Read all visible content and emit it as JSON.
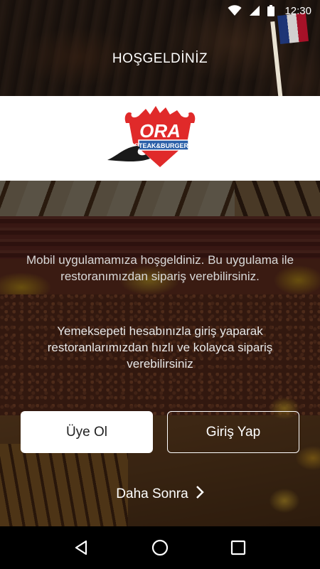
{
  "status_bar": {
    "time": "12:30",
    "icons": [
      "wifi-icon",
      "cellular-signal-icon",
      "battery-icon"
    ]
  },
  "header": {
    "title": "HOŞGELDİNİZ"
  },
  "logo": {
    "brand": "ORA",
    "tagline": "STEAK&BURGERS",
    "colors": {
      "red": "#e02a2a",
      "blue": "#2a5fa8",
      "black": "#1a1a1a"
    }
  },
  "intro": {
    "text": "Mobil uygulamamıza hoşgeldiniz. Bu uygulama ile restoranımızdan sipariş verebilirsiniz."
  },
  "login_info": {
    "text": "Yemeksepeti hesabınızla giriş yaparak restoranlarımızdan hızlı ve kolayca sipariş verebilirsiniz"
  },
  "buttons": {
    "register": "Üye Ol",
    "login": "Giriş Yap",
    "later": "Daha Sonra"
  },
  "nav_bar": {
    "icons": [
      "back-icon",
      "home-icon",
      "recents-icon"
    ]
  }
}
